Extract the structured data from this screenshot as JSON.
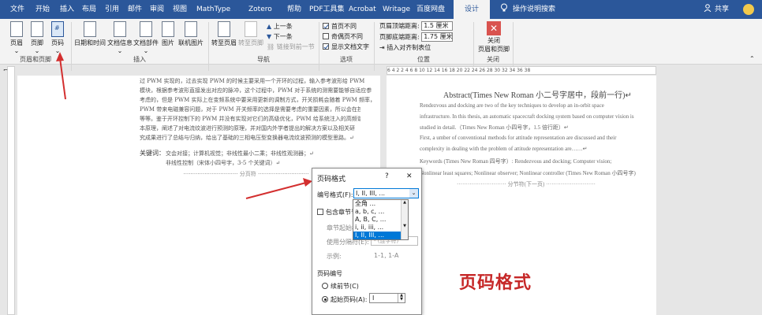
{
  "tabs": [
    "文件",
    "开始",
    "插入",
    "布局",
    "引用",
    "邮件",
    "审阅",
    "视图",
    "MathType",
    "Zotero",
    "帮助",
    "PDF工具集",
    "Acrobat",
    "Writage",
    "百度网盘",
    "设计"
  ],
  "tell_me": "操作说明搜索",
  "share": "共享",
  "ribbon": {
    "hf": {
      "header": "页眉",
      "footer": "页脚",
      "page_number": "页码",
      "group": "页眉和页脚"
    },
    "insert": {
      "datetime": "日期和时间",
      "docinfo": "文档信息",
      "docparts": "文档部件",
      "picture": "图片",
      "online_picture": "联机图片",
      "group": "插入"
    },
    "nav": {
      "goto_header": "转至页眉",
      "goto_footer": "转至页脚",
      "prev": "上一条",
      "next": "下一条",
      "link": "链接到前一节",
      "group": "导航"
    },
    "options": {
      "first_page": "首页不同",
      "odd_even": "奇偶页不同",
      "show_text": "显示文档文字",
      "group": "选项"
    },
    "position": {
      "header_top_label": "页眉顶端距离:",
      "header_top_value": "1.5 厘米",
      "footer_bottom_label": "页脚底端距离:",
      "footer_bottom_value": "1.75 厘米",
      "align_tab": "插入对齐制表位",
      "group": "位置"
    },
    "close": {
      "label1": "关闭",
      "label2": "页眉和页脚",
      "group": "关闭"
    }
  },
  "ruler_numbers": "6 4 2 2 4 6 8 10 12 14 16 18 20 22 24 26 28 30 32 34 36 38",
  "left_page": {
    "lines": [
      "过 PWM 实现的，过去实现 PWM 的时候主要采用一个开环的过程，输入参考波形给 PWM",
      "模块，根据参考波形直接发出对应的脉冲，这个过程中，PWM 对于系统的测需要能够自适应参",
      "考虑的，但是 PWM 实际上在变频系统中要采用更新的调制方式，开关损耗会随着 PWM 频率，",
      "PWM 带来电磁兼容问题，对于 PWM 开关频率的选择是需要考虑的重要因素，所以会在控制中引入",
      "等等。鉴于开环控制下的 PWM 并没有实现对它们的高级优化，PWM 给系统注入的高频谐波会带来电磁干扰（EMI）的问题",
      "本原理，阐述了对电流纹波进行预测的原理，并对国内外学者提出的解决方案以及相关研",
      "究成果进行了总结与归纳，给出了基础的三相电压型变换器电流纹波预测的模型思路。↵"
    ],
    "kw_label": "关键词：",
    "kw_values": "交会对接；计算机视觉；非线性最小二乘；非线性观测器；↵",
    "kw_line2": "非线性控制（宋体小四号字，3-5 个关键词）↵",
    "break": "分页符"
  },
  "right_page": {
    "abstract_title": "Abstract(Times New Roman 小二号字居中，段前一行)↵",
    "p1": [
      "Rendezvous and docking are two of the key techniques to develop an in-orbit space",
      "infrastructure. In this thesis, an automatic spacecraft docking system based on computer vision is",
      "studied in detail.（Times New Roman 小四号字，1.5 倍行距）↵"
    ],
    "p2": [
      "First, a umber of conventional methods for attitude representation are discussed and their",
      "complexity in dealing with the problem of attitude representation are……↵"
    ],
    "kw": [
      "Keywords (Times New Roman 四号字）: Rendezvous and docking; Computer vision;",
      "Nonlinear least squares; Nonlinear observer; Nonlinear controller (Times New Roman 小四号字)"
    ],
    "break": "分节符(下一页)"
  },
  "dialog": {
    "title": "页码格式",
    "help": "?",
    "close": "✕",
    "format_label": "编号格式(F):",
    "format_value": "I, II, III, ...",
    "include_chapter": "包含章节号",
    "chapter_start": "章节起始样式",
    "separator_label": "使用分隔符(E):",
    "separator_value": "- (连字符)",
    "example_label": "示例:",
    "example_value": "1-1, 1-A",
    "numbering_label": "页码编号",
    "continue": "续前节(C)",
    "start_at": "起始页码(A):",
    "start_value": "I"
  },
  "dropdown_options": [
    "全角 ...",
    "a, b, c, ...",
    "A, B, C, ...",
    "i, ii, iii, ...",
    "I, II, III, ..."
  ],
  "annotation": "页码格式",
  "colors": {
    "accent": "#2b579a",
    "arrow": "#d32f2f",
    "select": "#0078d7",
    "annot": "#c62828"
  }
}
